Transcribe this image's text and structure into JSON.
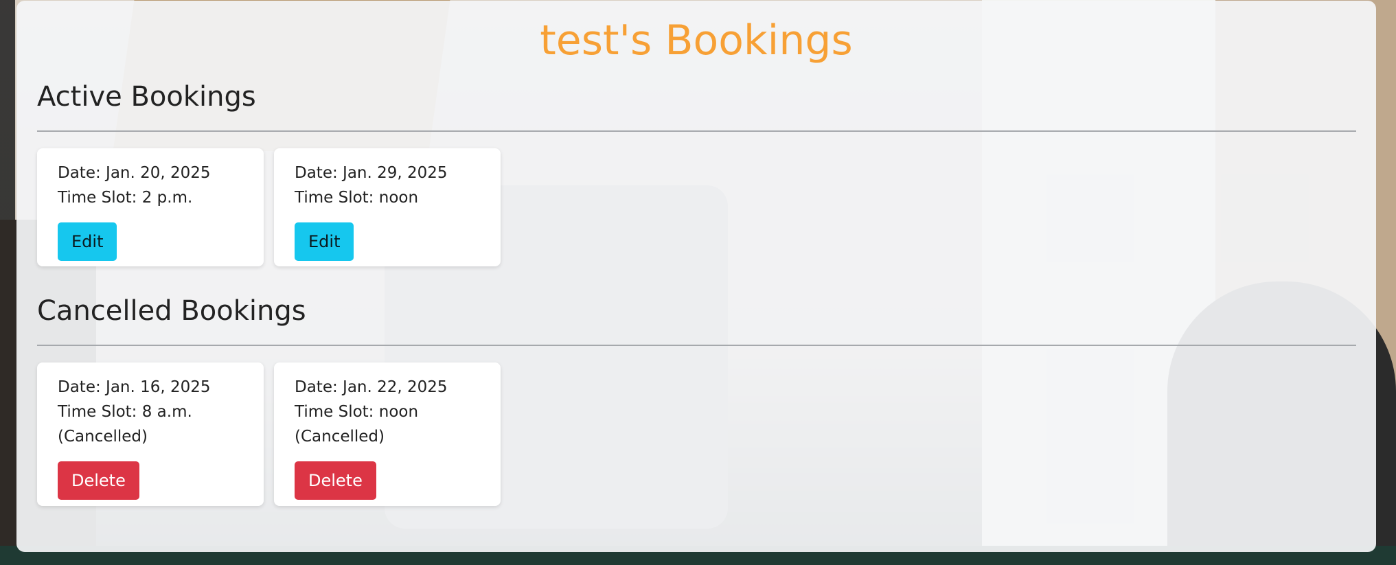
{
  "page": {
    "title": "test's Bookings"
  },
  "active": {
    "heading": "Active Bookings",
    "bookings": [
      {
        "date": "Date: Jan. 20, 2025",
        "time": "Time Slot: 2 p.m.",
        "button": "Edit"
      },
      {
        "date": "Date: Jan. 29, 2025",
        "time": "Time Slot: noon",
        "button": "Edit"
      }
    ]
  },
  "cancelled": {
    "heading": "Cancelled Bookings",
    "bookings": [
      {
        "date": "Date: Jan. 16, 2025",
        "time": "Time Slot: 8 a.m.",
        "status": "(Cancelled)",
        "button": "Delete"
      },
      {
        "date": "Date: Jan. 22, 2025",
        "time": "Time Slot: noon",
        "status": "(Cancelled)",
        "button": "Delete"
      }
    ]
  },
  "colors": {
    "title": "#f7a035",
    "edit_button": "#16c7ee",
    "delete_button": "#dc3545"
  }
}
